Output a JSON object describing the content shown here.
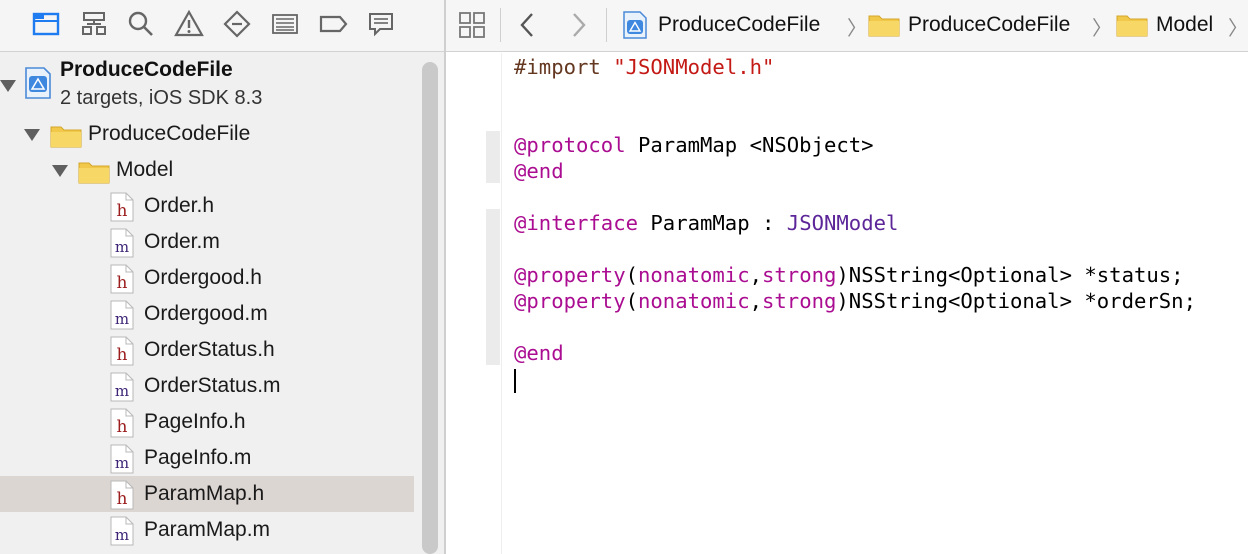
{
  "navigator": {
    "toolbar_icons": [
      "project-navigator-icon",
      "symbol-navigator-icon",
      "find-navigator-icon",
      "issue-navigator-icon",
      "test-navigator-icon",
      "debug-navigator-icon",
      "breakpoint-navigator-icon",
      "report-navigator-icon"
    ],
    "project": {
      "name": "ProduceCodeFile",
      "subtitle": "2 targets, iOS SDK 8.3"
    },
    "groups": [
      {
        "label": "ProduceCodeFile"
      },
      {
        "label": "Model"
      }
    ],
    "files": [
      {
        "label": "Order.h",
        "type": "h"
      },
      {
        "label": "Order.m",
        "type": "m"
      },
      {
        "label": "Ordergood.h",
        "type": "h"
      },
      {
        "label": "Ordergood.m",
        "type": "m"
      },
      {
        "label": "OrderStatus.h",
        "type": "h"
      },
      {
        "label": "OrderStatus.m",
        "type": "m"
      },
      {
        "label": "PageInfo.h",
        "type": "h"
      },
      {
        "label": "PageInfo.m",
        "type": "m"
      },
      {
        "label": "ParamMap.h",
        "type": "h",
        "selected": true
      },
      {
        "label": "ParamMap.m",
        "type": "m"
      }
    ]
  },
  "jumpbar": {
    "crumbs": [
      "ProduceCodeFile",
      "ProduceCodeFile",
      "Model"
    ]
  },
  "editor": {
    "lines": {
      "import_kw": "#import",
      "import_str": "\"JSONModel.h\"",
      "protocol_kw": "@protocol",
      "protocol_rest": " ParamMap <NSObject>",
      "end1": "@end",
      "interface_kw": "@interface",
      "interface_mid": " ParamMap : ",
      "interface_super": "JSONModel",
      "prop1_kw": "@property",
      "prop1_paren_open": "(",
      "prop1_attr1": "nonatomic",
      "prop1_comma": ",",
      "prop1_attr2": "strong",
      "prop1_rest": ")NSString<Optional> *status;",
      "prop2_kw": "@property",
      "prop2_paren_open": "(",
      "prop2_attr1": "nonatomic",
      "prop2_comma": ",",
      "prop2_attr2": "strong",
      "prop2_rest": ")NSString<Optional> *orderSn;",
      "end2": "@end"
    }
  },
  "colors": {
    "keyword": "#aa0d91",
    "string": "#c41a16",
    "preprocessor": "#643820",
    "class": "#5c2699",
    "header_icon": "#9b1c1c",
    "impl_icon": "#3e2577",
    "selection": "#dcd6d2",
    "folder": "#f2c84b"
  }
}
